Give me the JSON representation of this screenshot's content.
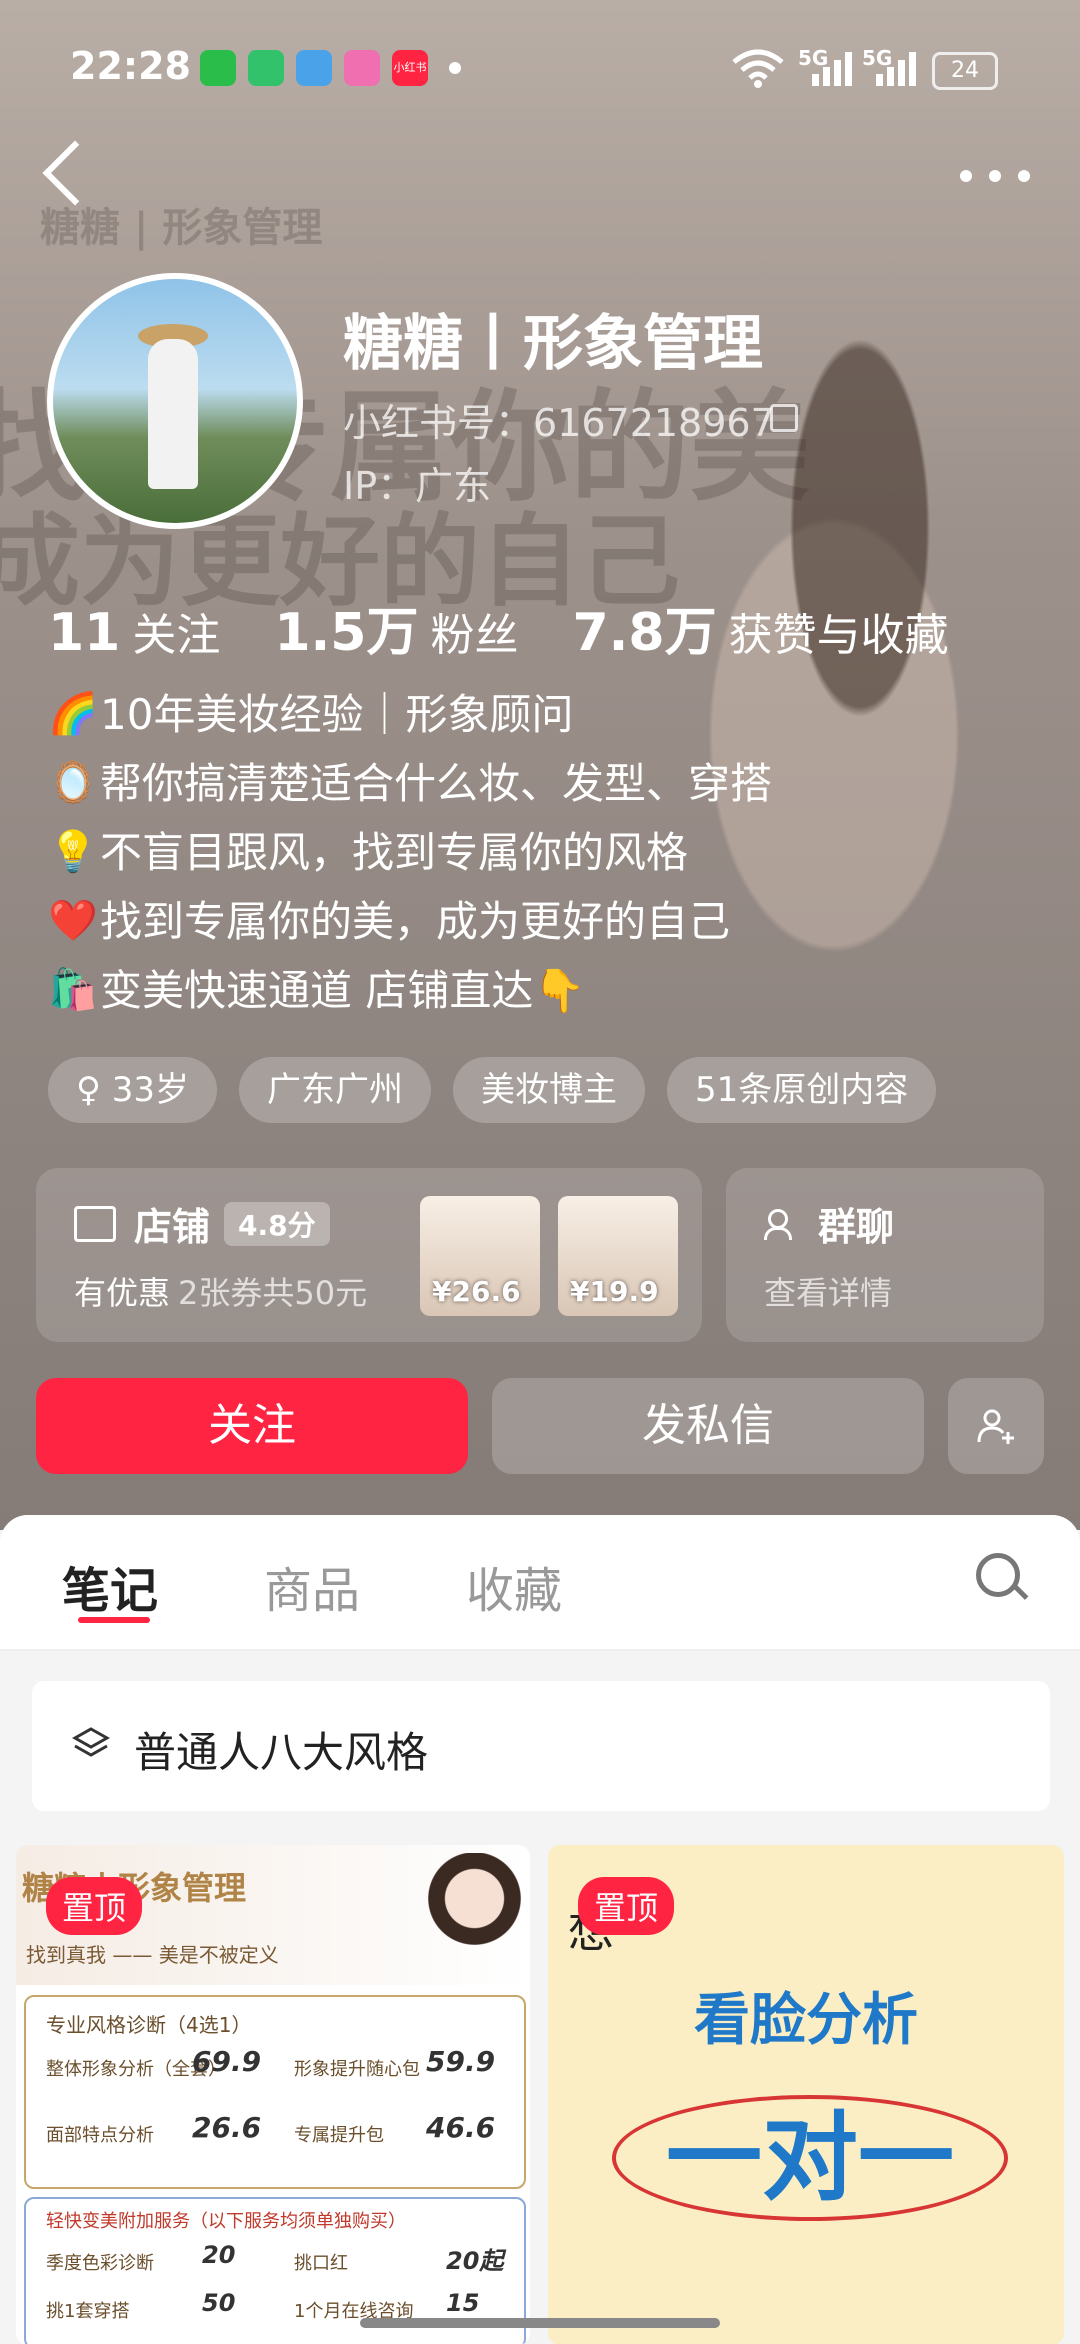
{
  "status_bar": {
    "time": "22:28",
    "apps": [
      {
        "icon": "wechat-icon",
        "color": "#2bbd4a",
        "label": ""
      },
      {
        "icon": "sync-app-icon",
        "color": "#31c26b",
        "label": ""
      },
      {
        "icon": "weather-icon",
        "color": "#4aa3e8",
        "label": ""
      },
      {
        "icon": "camera-app-icon",
        "color": "#f06fb0",
        "label": ""
      },
      {
        "icon": "xiaohongshu-icon",
        "color": "#ff2442",
        "label": "小红书"
      }
    ],
    "signal1": "5G",
    "signal2": "5G",
    "battery": "24"
  },
  "hero_bg": {
    "line1": "糖糖 | 形象管理",
    "line2": "找到专属你的美",
    "line3": "成为更好的自己"
  },
  "profile": {
    "name": "糖糖丨形象管理",
    "red_id": "小红书号：6167218967",
    "ip": "IP：广东",
    "stats": {
      "following_num": "11",
      "following_label": "关注",
      "fans_num": "1.5万",
      "fans_label": "粉丝",
      "likes_num": "7.8万",
      "likes_label": "获赞与收藏"
    },
    "bio": [
      {
        "emoji": "🌈",
        "text": "10年美妆经验｜形象顾问"
      },
      {
        "emoji": "🪞",
        "text": "帮你搞清楚适合什么妆、发型、穿搭"
      },
      {
        "emoji": "💡",
        "text": "不盲目跟风，找到专属你的风格"
      },
      {
        "emoji": "❤️",
        "text": "找到专属你的美，成为更好的自己"
      },
      {
        "emoji": "🛍️",
        "text": "变美快速通道 店铺直达👇"
      }
    ],
    "tags": [
      "♀ 33岁",
      "广东广州",
      "美妆博主",
      "51条原创内容"
    ]
  },
  "shop": {
    "title": "店铺",
    "rating": "4.8分",
    "promo_label": "有优惠",
    "promo_detail": "2张券共50元",
    "products": [
      {
        "price": "¥26.6"
      },
      {
        "price": "¥19.9"
      }
    ]
  },
  "group_chat": {
    "title": "群聊",
    "subtitle": "查看详情"
  },
  "actions": {
    "follow": "关注",
    "message": "发私信"
  },
  "tabs": [
    "笔记",
    "商品",
    "收藏"
  ],
  "active_tab": "笔记",
  "collection": {
    "label": "普通人八大风格"
  },
  "notes": [
    {
      "pinned_label": "置顶",
      "title": "糖糖丨形象管理",
      "tagline": "找到真我 —— 美是不被定义",
      "header_line": "专业风格诊断（4选1）",
      "items": [
        {
          "name": "整体形象分析（全套）",
          "price": "69.9"
        },
        {
          "name": "形象提升随心包",
          "price": "59.9"
        },
        {
          "name": "面部特点分析",
          "price": "26.6"
        },
        {
          "name": "专属提升包",
          "price": "46.6"
        }
      ],
      "extra_line": "轻快变美附加服务（以下服务均须单独购买）",
      "extras": [
        {
          "name": "季度色彩诊断",
          "price": "20"
        },
        {
          "name": "挑口红",
          "price": "20起"
        },
        {
          "name": "挑1套穿搭",
          "price": "50"
        },
        {
          "name": "1个月在线咨询",
          "price": "15"
        }
      ]
    },
    {
      "pinned_label": "置顶",
      "script_text": "想",
      "title": "看脸分析",
      "big_text": "一对一"
    }
  ]
}
